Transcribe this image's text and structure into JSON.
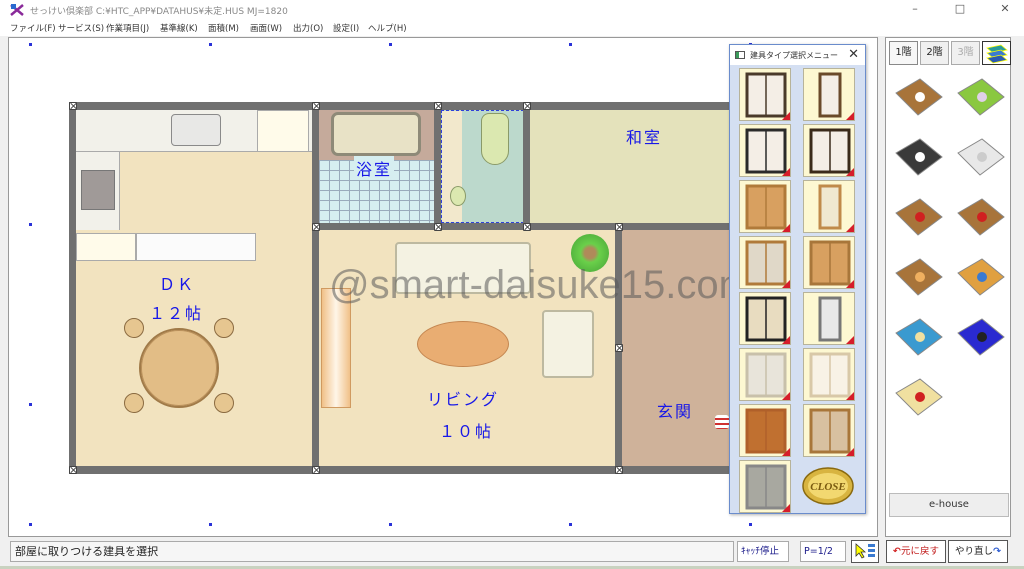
{
  "window": {
    "title": "せっけい倶楽部 C:¥HTC_APP¥DATAHUS¥未定.HUS  MJ=1820",
    "minimize_label": "–",
    "maximize_label": "□",
    "close_label": "✕"
  },
  "menu": [
    {
      "label": "ファイル(F)"
    },
    {
      "label": "サービス(S)"
    },
    {
      "label": "作業項目(J)"
    },
    {
      "label": "基準線(K)"
    },
    {
      "label": "面積(M)"
    },
    {
      "label": "画面(W)"
    },
    {
      "label": "出力(O)"
    },
    {
      "label": "設定(I)"
    },
    {
      "label": "ヘルプ(H)"
    }
  ],
  "floor_plan": {
    "rooms": [
      {
        "id": "dk",
        "label_line1": "ＤＫ",
        "label_line2": "１２帖",
        "color": "#f2e3bf"
      },
      {
        "id": "bath",
        "label": "浴室",
        "color": "#d6eef0"
      },
      {
        "id": "toilet",
        "label": "",
        "color": "#bcd9cc"
      },
      {
        "id": "washitsu",
        "label": "和室",
        "color": "#e4e2bb"
      },
      {
        "id": "living",
        "label_line1": "リビング",
        "label_line2": "１０帖",
        "color": "#f2e3bf"
      },
      {
        "id": "genkan",
        "label": "玄関",
        "color": "#cfb29a"
      }
    ],
    "wall_color": "#707070",
    "label_color": "#1818e8"
  },
  "watermark": "@smart-daisuke15.com",
  "door_dialog": {
    "title": "建具タイプ選択メニュー",
    "close_label": "✕",
    "items": [
      {
        "name": "sliding-window"
      },
      {
        "name": "single-window"
      },
      {
        "name": "double-hung-window"
      },
      {
        "name": "bay-window"
      },
      {
        "name": "closet-door"
      },
      {
        "name": "glass-swing-door"
      },
      {
        "name": "half-glass-closet-door"
      },
      {
        "name": "panel-folding-door"
      },
      {
        "name": "shoji-sliding-window"
      },
      {
        "name": "narrow-glass-door"
      },
      {
        "name": "fusuma-sliding-door"
      },
      {
        "name": "shoji-screen"
      },
      {
        "name": "entrance-door"
      },
      {
        "name": "lattice-sliding-door"
      },
      {
        "name": "shutter"
      }
    ],
    "close_button_label": "CLOSE"
  },
  "side_panel": {
    "floor_tabs": [
      {
        "label": "1階",
        "enabled": true,
        "active": true
      },
      {
        "label": "2階",
        "enabled": true,
        "active": false
      },
      {
        "label": "3階",
        "enabled": false,
        "active": false
      }
    ],
    "tools": [
      {
        "name": "room-tool"
      },
      {
        "name": "garden-tool"
      },
      {
        "name": "roof-tool"
      },
      {
        "name": "wall-tool"
      },
      {
        "name": "stairs-tool"
      },
      {
        "name": "connect-room-tool"
      },
      {
        "name": "door-tool"
      },
      {
        "name": "furniture-tool"
      },
      {
        "name": "interior-3d-tool"
      },
      {
        "name": "eraser-tool"
      },
      {
        "name": "move-tool"
      }
    ],
    "ehouse_label": "e-house"
  },
  "statusbar": {
    "message": "部屋に取りつける建具を選択",
    "snap_label": "ｷｬｯﾁ停止",
    "page_label": "P=1/2",
    "undo_label": "元に戻す",
    "redo_label": "やり直し"
  }
}
